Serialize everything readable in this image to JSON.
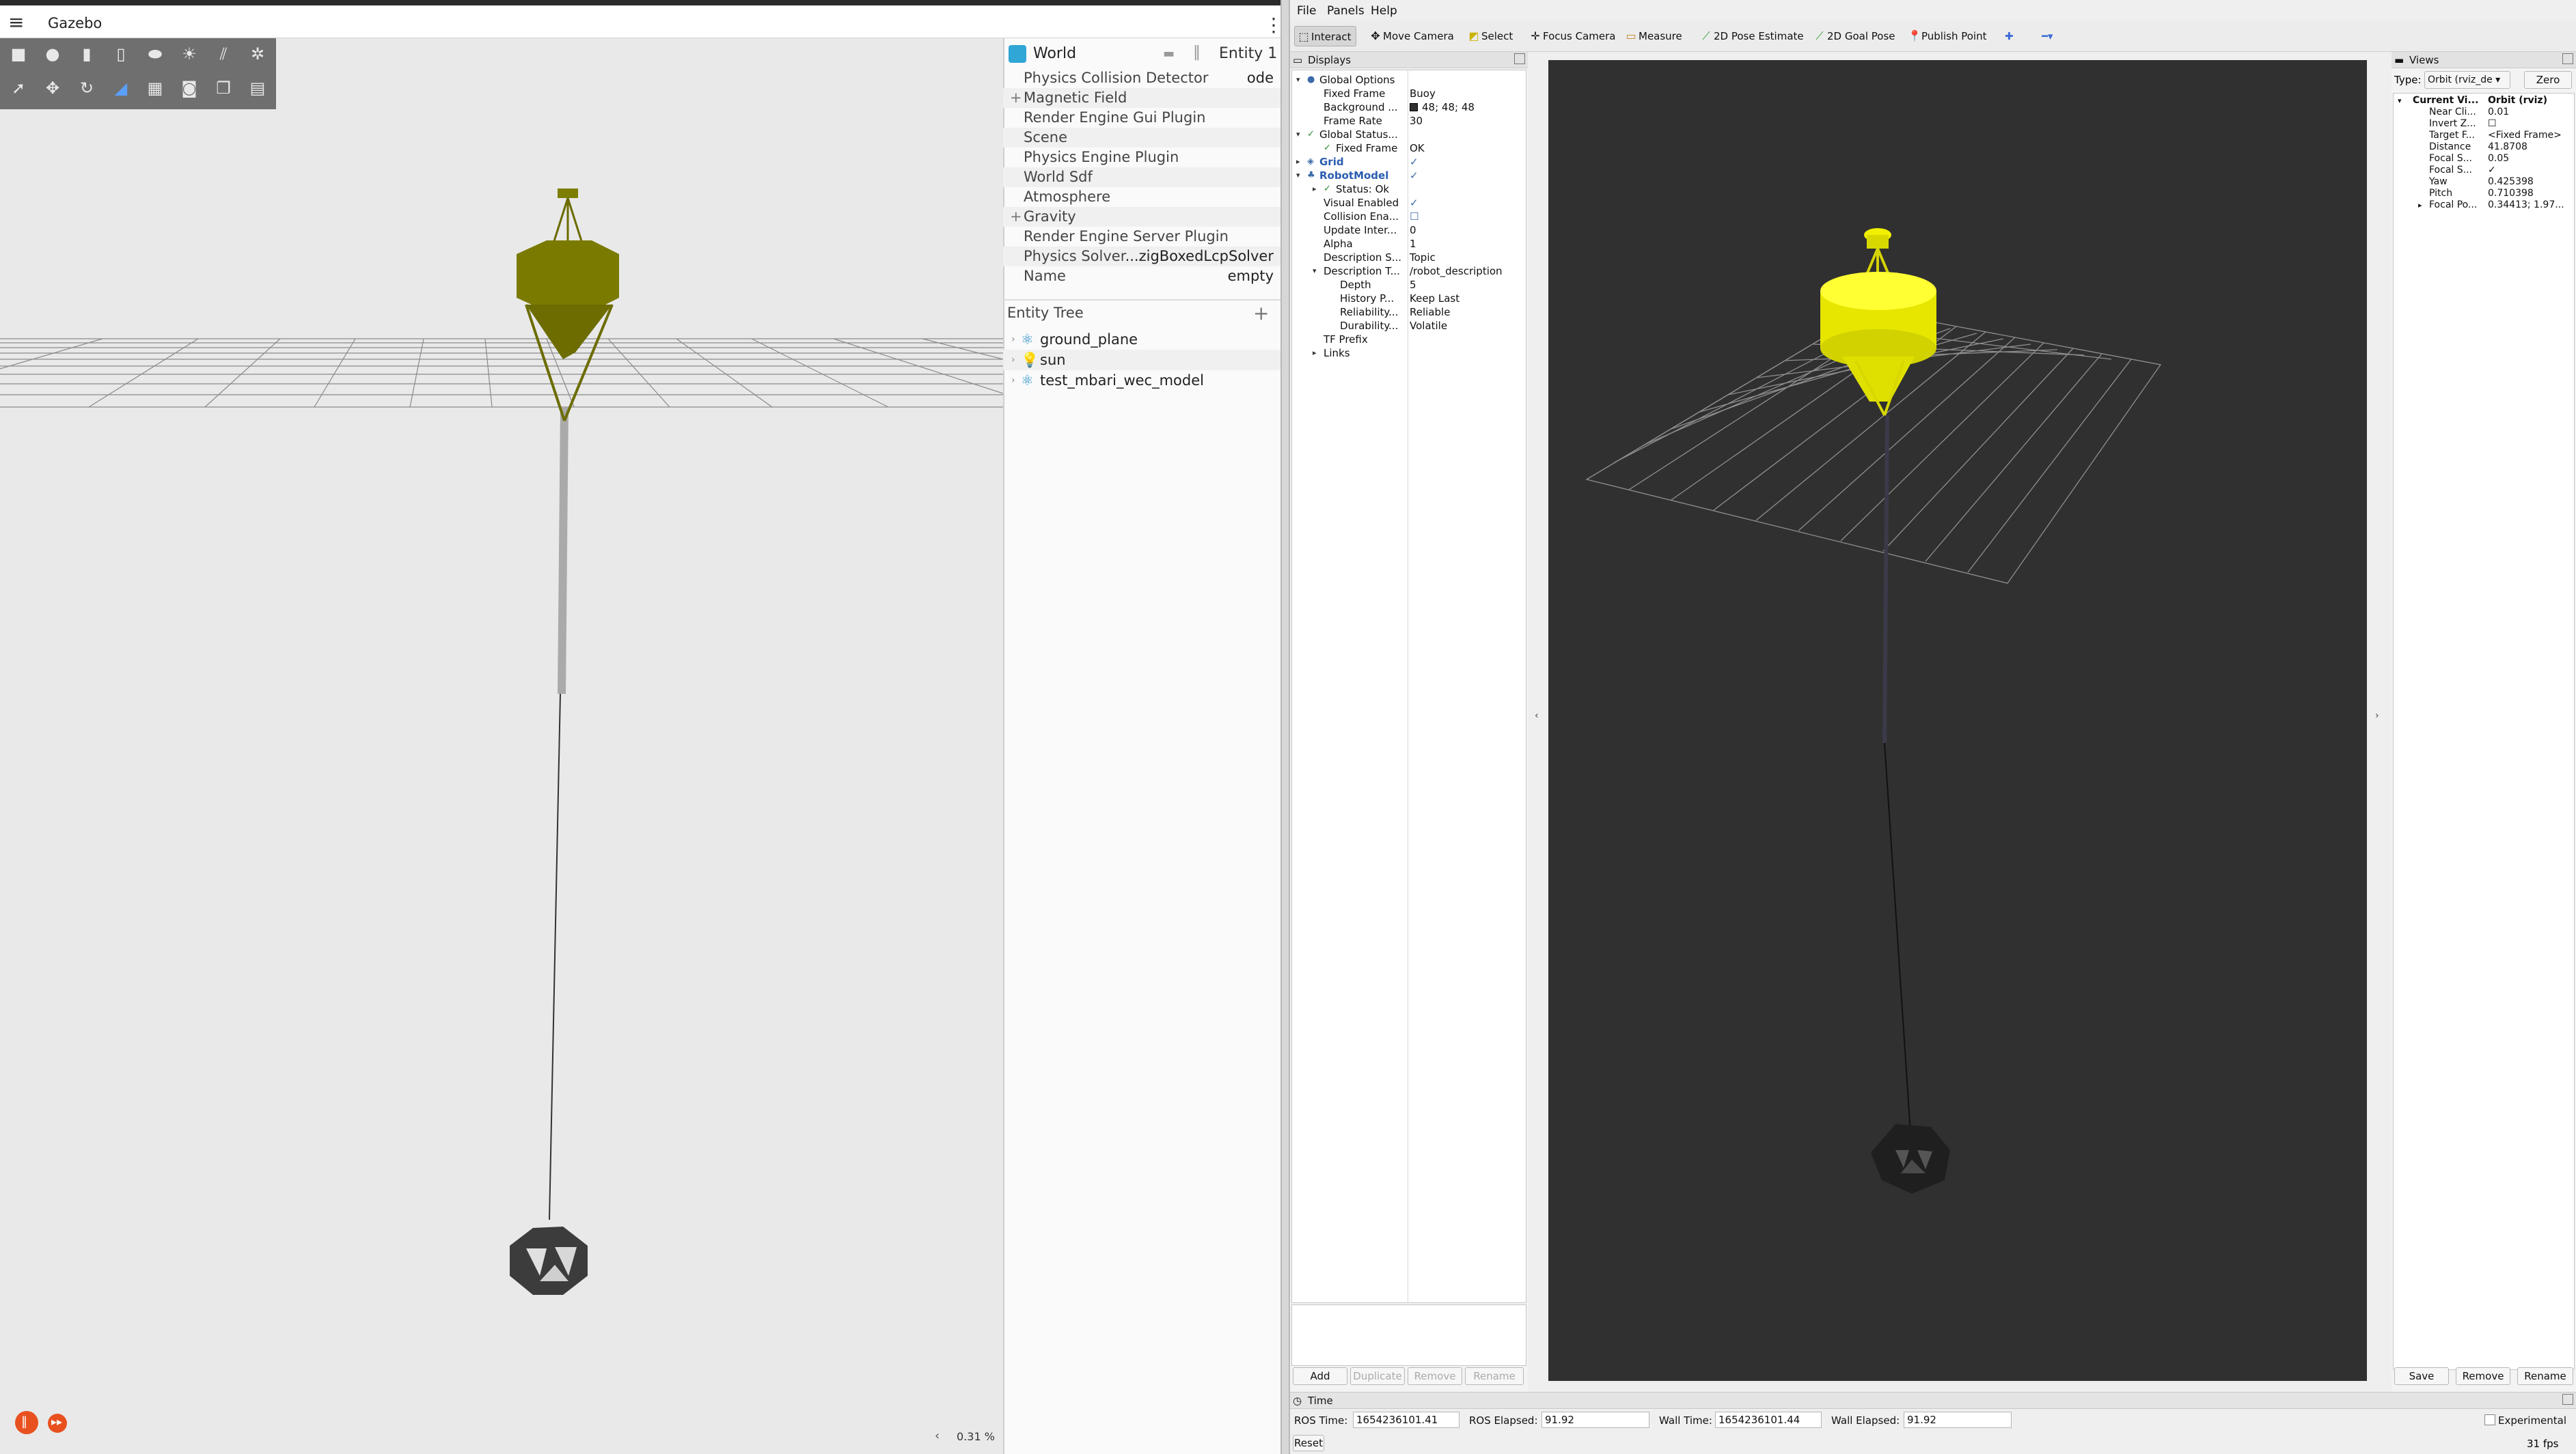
{
  "gazebo": {
    "title": "Gazebo",
    "menu_icon": "hamburger-icon",
    "kebab_icon": "more-vert-icon",
    "world_panel": {
      "title": "World",
      "entity_label": "Entity 1",
      "properties": [
        {
          "label": "Physics Collision Detector",
          "value": "ode",
          "expand": false
        },
        {
          "label": "Magnetic Field",
          "value": "",
          "expand": true
        },
        {
          "label": "Render Engine Gui Plugin",
          "value": "",
          "expand": false
        },
        {
          "label": "Scene",
          "value": "",
          "expand": false
        },
        {
          "label": "Physics Engine Plugin",
          "value": "",
          "expand": false
        },
        {
          "label": "World Sdf",
          "value": "",
          "expand": false
        },
        {
          "label": "Atmosphere",
          "value": "",
          "expand": false
        },
        {
          "label": "Gravity",
          "value": "",
          "expand": true
        },
        {
          "label": "Render Engine Server Plugin",
          "value": "",
          "expand": false
        },
        {
          "label": "Physics Solver",
          "value": "...zigBoxedLcpSolver",
          "expand": false
        },
        {
          "label": "Name",
          "value": "empty",
          "expand": false
        }
      ]
    },
    "entity_tree": {
      "title": "Entity Tree",
      "items": [
        "ground_plane",
        "sun",
        "test_mbari_wec_model"
      ]
    },
    "rtf": "0.31 %"
  },
  "rviz": {
    "menu": [
      "File",
      "Panels",
      "Help"
    ],
    "tools": [
      "Interact",
      "Move Camera",
      "Select",
      "Focus Camera",
      "Measure",
      "2D Pose Estimate",
      "2D Goal Pose",
      "Publish Point"
    ],
    "displays": {
      "title": "Displays",
      "rows": [
        {
          "k": "Global Options",
          "v": "",
          "lvl": 0,
          "arrow": "▾",
          "icon": "●"
        },
        {
          "k": "Fixed Frame",
          "v": "Buoy",
          "lvl": 1
        },
        {
          "k": "Background ...",
          "v": "48; 48; 48",
          "lvl": 1,
          "swatch": true
        },
        {
          "k": "Frame Rate",
          "v": "30",
          "lvl": 1
        },
        {
          "k": "Global Status...",
          "v": "",
          "lvl": 0,
          "arrow": "▾",
          "icon": "✓"
        },
        {
          "k": "Fixed Frame",
          "v": "OK",
          "lvl": 1,
          "icon": "✓"
        },
        {
          "k": "Grid",
          "v": "✓",
          "lvl": 0,
          "arrow": "▸",
          "icon": "◈",
          "blue": true
        },
        {
          "k": "RobotModel",
          "v": "✓",
          "lvl": 0,
          "arrow": "▾",
          "icon": "♣",
          "blue": true
        },
        {
          "k": "Status: Ok",
          "v": "",
          "lvl": 1,
          "arrow": "▸",
          "icon": "✓"
        },
        {
          "k": "Visual Enabled",
          "v": "✓",
          "lvl": 1
        },
        {
          "k": "Collision Ena...",
          "v": "☐",
          "lvl": 1
        },
        {
          "k": "Update Inter...",
          "v": "0",
          "lvl": 1
        },
        {
          "k": "Alpha",
          "v": "1",
          "lvl": 1
        },
        {
          "k": "Description S...",
          "v": "Topic",
          "lvl": 1
        },
        {
          "k": "Description T...",
          "v": "/robot_description",
          "lvl": 1,
          "arrow": "▾"
        },
        {
          "k": "Depth",
          "v": "5",
          "lvl": 2
        },
        {
          "k": "History P...",
          "v": "Keep Last",
          "lvl": 2
        },
        {
          "k": "Reliability...",
          "v": "Reliable",
          "lvl": 2
        },
        {
          "k": "Durability...",
          "v": "Volatile",
          "lvl": 2
        },
        {
          "k": "TF Prefix",
          "v": "",
          "lvl": 1
        },
        {
          "k": "Links",
          "v": "",
          "lvl": 1,
          "arrow": "▸"
        }
      ],
      "buttons": [
        "Add",
        "Duplicate",
        "Remove",
        "Rename"
      ]
    },
    "views": {
      "title": "Views",
      "type_label": "Type:",
      "type_value": "Orbit (rviz_de ▾",
      "zero_label": "Zero",
      "rows": [
        {
          "k": "Current Vi...",
          "v": "Orbit (rviz)",
          "bold": true,
          "arrow": "▾"
        },
        {
          "k": "Near Cli...",
          "v": "0.01"
        },
        {
          "k": "Invert Z...",
          "v": "☐"
        },
        {
          "k": "Target F...",
          "v": "<Fixed Frame>"
        },
        {
          "k": "Distance",
          "v": "41.8708"
        },
        {
          "k": "Focal S...",
          "v": "0.05"
        },
        {
          "k": "Focal S...",
          "v": "✓"
        },
        {
          "k": "Yaw",
          "v": "0.425398"
        },
        {
          "k": "Pitch",
          "v": "0.710398"
        },
        {
          "k": "Focal Po...",
          "v": "0.34413; 1.97...",
          "arrow": "▸"
        }
      ],
      "buttons": [
        "Save",
        "Remove",
        "Rename"
      ]
    },
    "time": {
      "title": "Time",
      "ros_time_label": "ROS Time:",
      "ros_time": "1654236101.41",
      "ros_elapsed_label": "ROS Elapsed:",
      "ros_elapsed": "91.92",
      "wall_time_label": "Wall Time:",
      "wall_time": "1654236101.44",
      "wall_elapsed_label": "Wall Elapsed:",
      "wall_elapsed": "91.92",
      "experimental_label": "Experimental",
      "reset_label": "Reset",
      "fps": "31 fps"
    }
  }
}
